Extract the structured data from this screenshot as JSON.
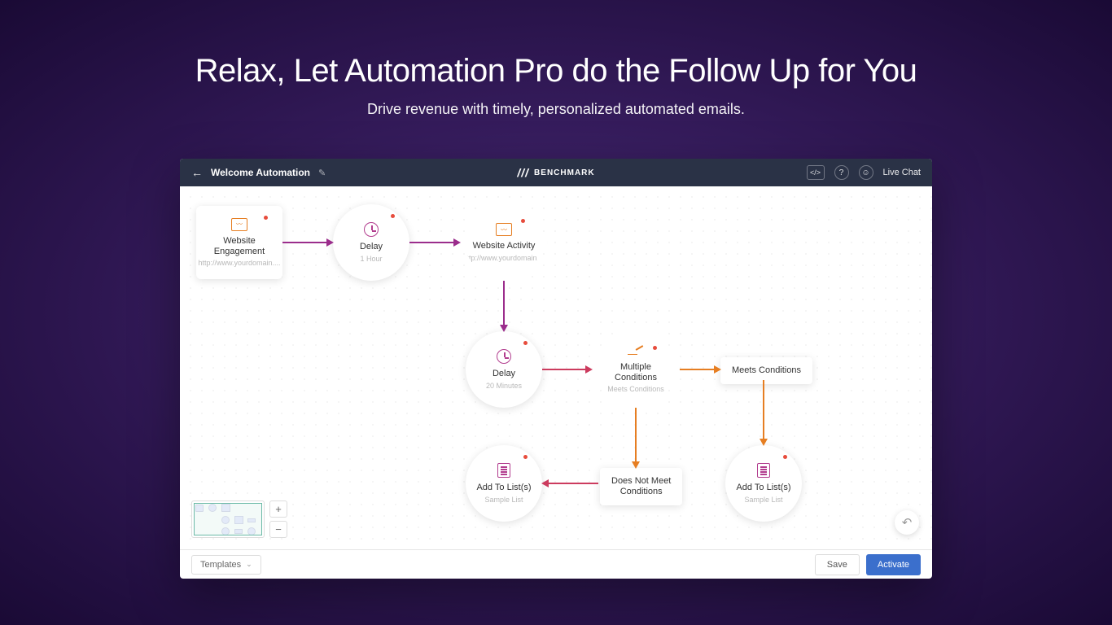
{
  "hero": {
    "title": "Relax, Let Automation Pro do the Follow Up for You",
    "subtitle": "Drive revenue with timely, personalized automated emails."
  },
  "topbar": {
    "title": "Welcome Automation",
    "brand": "BENCHMARK",
    "livechat": "Live Chat"
  },
  "nodes": {
    "website_engagement": {
      "title": "Website Engagement",
      "sub": "http://www.yourdomain...."
    },
    "delay1": {
      "title": "Delay",
      "sub": "1 Hour"
    },
    "website_activity": {
      "title": "Website Activity",
      "sub": "http://www.yourdomain...."
    },
    "delay2": {
      "title": "Delay",
      "sub": "20 Minutes"
    },
    "multiple_conditions": {
      "title": "Multiple Conditions",
      "sub": "Meets Conditions"
    },
    "meets_conditions": {
      "title": "Meets Conditions"
    },
    "does_not_meet": {
      "title_line1": "Does Not Meet",
      "title_line2": "Conditions"
    },
    "add_to_list1": {
      "title": "Add To List(s)",
      "sub": "Sample List"
    },
    "add_to_list2": {
      "title": "Add To List(s)",
      "sub": "Sample List"
    }
  },
  "footer": {
    "templates": "Templates",
    "save": "Save",
    "activate": "Activate"
  },
  "colors": {
    "purple": "#9b2d8c",
    "orange": "#e67e22",
    "red": "#cc3b5e"
  }
}
